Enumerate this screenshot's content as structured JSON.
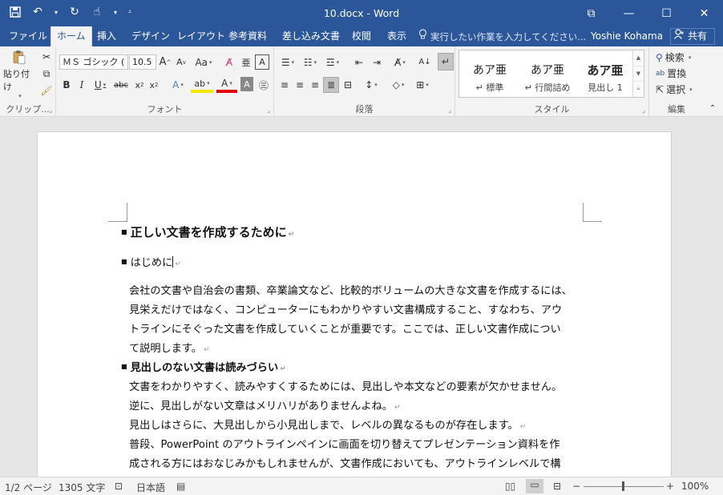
{
  "window": {
    "title": "10.docx - Word",
    "controls": {
      "restore_glyph": "⧉",
      "minimize_glyph": "—",
      "maximize_glyph": "☐",
      "close_glyph": "✕"
    }
  },
  "qat": {
    "save_icon": "save-icon",
    "undo_icon": "undo-icon",
    "redo_icon": "redo-icon",
    "touch_icon": "touch-mode-icon"
  },
  "tabs": [
    {
      "label": "ファイル"
    },
    {
      "label": "ホーム"
    },
    {
      "label": "挿入"
    },
    {
      "label": "デザイン"
    },
    {
      "label": "レイアウト"
    },
    {
      "label": "参考資料"
    },
    {
      "label": "差し込み文書"
    },
    {
      "label": "校閲"
    },
    {
      "label": "表示"
    }
  ],
  "tellme": {
    "placeholder": "実行したい作業を入力してください..."
  },
  "user": {
    "name": "Yoshie Kohama"
  },
  "share": {
    "label": "共有"
  },
  "ribbon": {
    "clipboard": {
      "label": "クリップ...",
      "paste_label": "貼り付け"
    },
    "font": {
      "label": "フォント",
      "font_name": "ＭＳ ゴシック (",
      "font_size": "10.5"
    },
    "paragraph": {
      "label": "段落"
    },
    "styles": {
      "label": "スタイル",
      "items": [
        {
          "sample": "あア亜",
          "name": "↵ 標準"
        },
        {
          "sample": "あア亜",
          "name": "↵ 行間詰め"
        },
        {
          "sample": "あア亜",
          "name": "見出し 1"
        }
      ]
    },
    "editing": {
      "label": "編集",
      "find": "検索",
      "replace": "置換",
      "select": "選択"
    }
  },
  "document": {
    "heading_main": "正しい文書を作成するために",
    "heading_intro": "はじめに",
    "para1": [
      "会社の文書や自治会の書類、卒業論文など、比較的ボリュームの大きな文書を作成するには、",
      "見栄えだけではなく、コンピューターにもわかりやすい文書構成すること、すなわち、アウ",
      "トラインにそぐった文書を作成していくことが重要です。ここでは、正しい文書作成につい",
      "て説明します。"
    ],
    "heading_section": "見出しのない文書は読みづらい",
    "para2": [
      "文書をわかりやすく、読みやすくするためには、見出しや本文などの要素が欠かせません。",
      "逆に、見出しがない文章はメリハリがありませんよね。",
      "見出しはさらに、大見出しから小見出しまで、レベルの異なるものが存在します。",
      "普段、PowerPoint のアウトラインペインに画面を切り替えてプレゼンテーション資料を作",
      "成される方にはおなじみかもしれませんが、文書作成においても、アウトラインレベルで構"
    ]
  },
  "status": {
    "page": "1/2 ページ",
    "words": "1305 文字",
    "language": "日本語",
    "zoom": "100%",
    "zoom_fraction": 0.5
  },
  "colors": {
    "accent": "#2b579a",
    "ribbon_bg": "#f3f3f3",
    "doc_bg": "#e6e6e6"
  }
}
